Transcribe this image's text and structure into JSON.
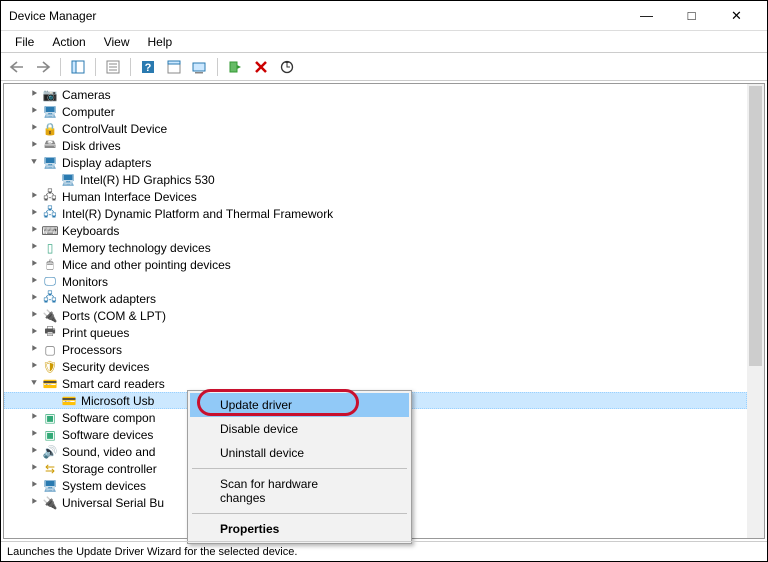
{
  "window": {
    "title": "Device Manager"
  },
  "menubar": [
    "File",
    "Action",
    "View",
    "Help"
  ],
  "tree": [
    {
      "indent": 1,
      "arrow": "r",
      "icon": "📷",
      "icls": "i-camera",
      "label": "Cameras"
    },
    {
      "indent": 1,
      "arrow": "r",
      "icon": "🖥",
      "icls": "i-computer",
      "label": "Computer"
    },
    {
      "indent": 1,
      "arrow": "r",
      "icon": "🔒",
      "icls": "i-cv",
      "label": "ControlVault Device"
    },
    {
      "indent": 1,
      "arrow": "r",
      "icon": "🖴",
      "icls": "i-disk",
      "label": "Disk drives"
    },
    {
      "indent": 1,
      "arrow": "d",
      "icon": "🖥",
      "icls": "i-display",
      "label": "Display adapters"
    },
    {
      "indent": 2,
      "arrow": " ",
      "icon": "🖥",
      "icls": "i-gpu",
      "label": "Intel(R) HD Graphics 530"
    },
    {
      "indent": 1,
      "arrow": "r",
      "icon": "🖧",
      "icls": "i-hid",
      "label": "Human Interface Devices"
    },
    {
      "indent": 1,
      "arrow": "r",
      "icon": "🖧",
      "icls": "i-intel",
      "label": "Intel(R) Dynamic Platform and Thermal Framework"
    },
    {
      "indent": 1,
      "arrow": "r",
      "icon": "⌨",
      "icls": "i-kb",
      "label": "Keyboards"
    },
    {
      "indent": 1,
      "arrow": "r",
      "icon": "▯",
      "icls": "i-mem",
      "label": "Memory technology devices"
    },
    {
      "indent": 1,
      "arrow": "r",
      "icon": "🖱",
      "icls": "i-mouse",
      "label": "Mice and other pointing devices"
    },
    {
      "indent": 1,
      "arrow": "r",
      "icon": "🖵",
      "icls": "i-mon",
      "label": "Monitors"
    },
    {
      "indent": 1,
      "arrow": "r",
      "icon": "🖧",
      "icls": "i-net",
      "label": "Network adapters"
    },
    {
      "indent": 1,
      "arrow": "r",
      "icon": "🔌",
      "icls": "i-port",
      "label": "Ports (COM & LPT)"
    },
    {
      "indent": 1,
      "arrow": "r",
      "icon": "🖶",
      "icls": "i-print",
      "label": "Print queues"
    },
    {
      "indent": 1,
      "arrow": "r",
      "icon": "▢",
      "icls": "i-cpu",
      "label": "Processors"
    },
    {
      "indent": 1,
      "arrow": "r",
      "icon": "🛡",
      "icls": "i-sec",
      "label": "Security devices"
    },
    {
      "indent": 1,
      "arrow": "d",
      "icon": "💳",
      "icls": "i-scard",
      "label": "Smart card readers"
    },
    {
      "indent": 2,
      "arrow": " ",
      "icon": "💳",
      "icls": "i-scard",
      "label": "Microsoft Usb",
      "selected": true
    },
    {
      "indent": 1,
      "arrow": "r",
      "icon": "▣",
      "icls": "i-sw",
      "label": "Software compon"
    },
    {
      "indent": 1,
      "arrow": "r",
      "icon": "▣",
      "icls": "i-swdev",
      "label": "Software devices"
    },
    {
      "indent": 1,
      "arrow": "r",
      "icon": "🔊",
      "icls": "i-sound",
      "label": "Sound, video and"
    },
    {
      "indent": 1,
      "arrow": "r",
      "icon": "⇆",
      "icls": "i-storage",
      "label": "Storage controller"
    },
    {
      "indent": 1,
      "arrow": "r",
      "icon": "🖥",
      "icls": "i-sys",
      "label": "System devices"
    },
    {
      "indent": 1,
      "arrow": "r",
      "icon": "🔌",
      "icls": "i-usb",
      "label": "Universal Serial Bu"
    }
  ],
  "contextMenu": {
    "items": [
      {
        "label": "Update driver",
        "hl": true
      },
      {
        "label": "Disable device"
      },
      {
        "label": "Uninstall device"
      },
      {
        "sep": true
      },
      {
        "label": "Scan for hardware changes"
      },
      {
        "sep": true
      },
      {
        "label": "Properties",
        "bold": true
      }
    ]
  },
  "statusbar": {
    "text": "Launches the Update Driver Wizard for the selected device."
  }
}
